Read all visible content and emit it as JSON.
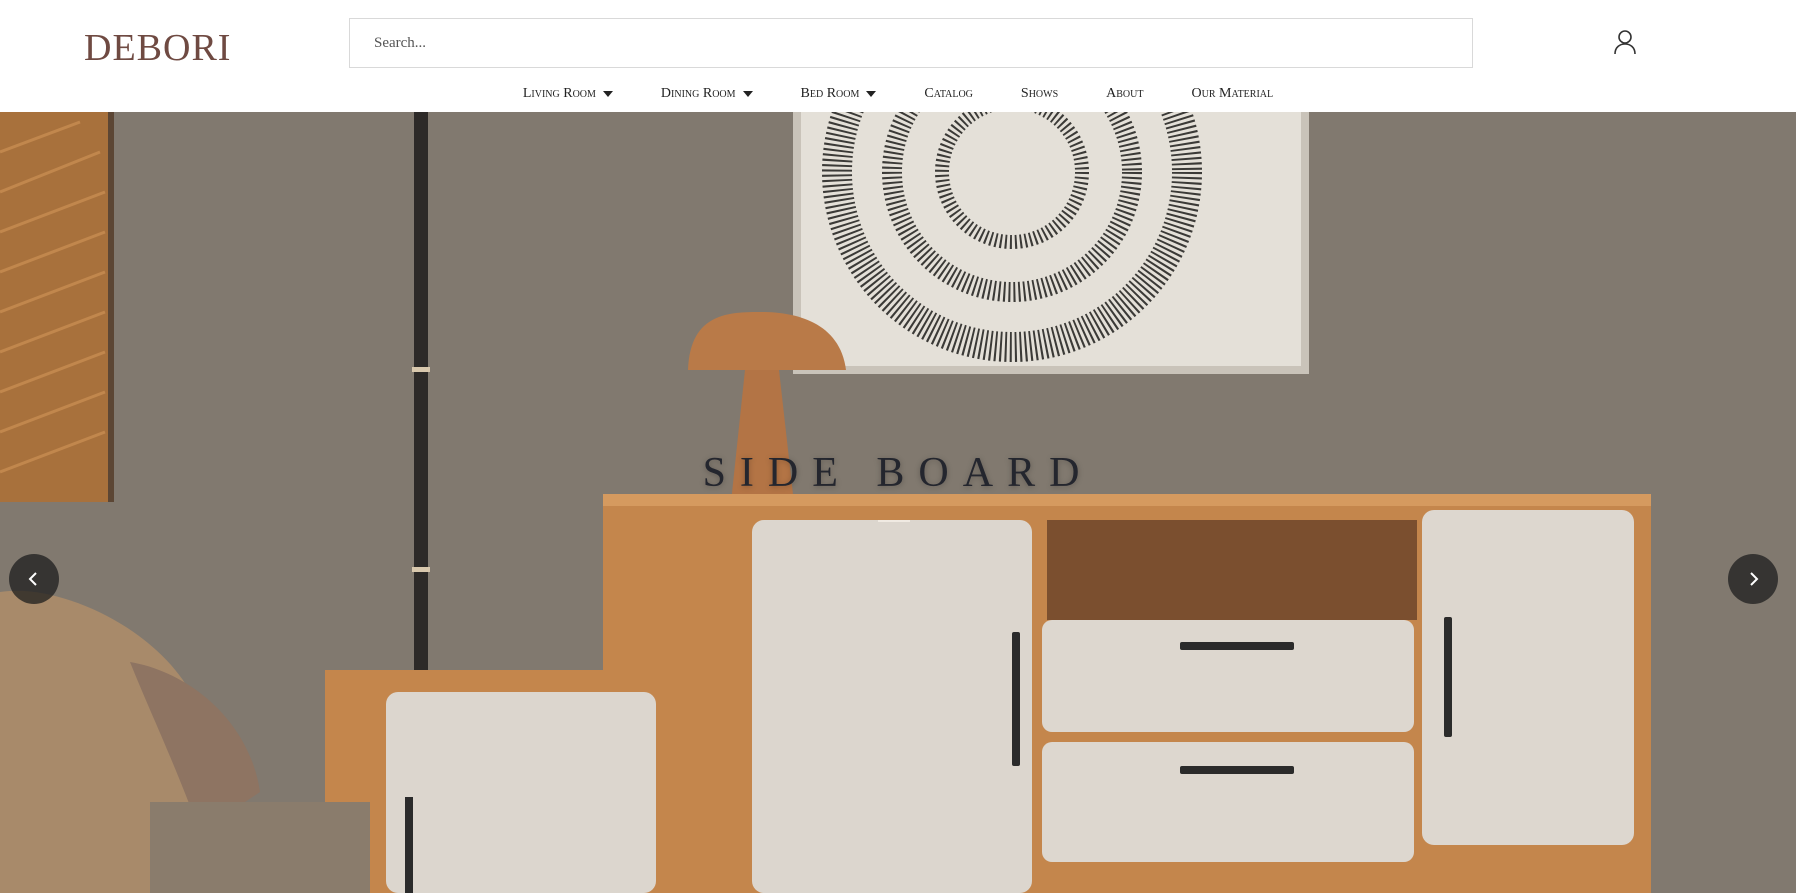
{
  "brand": {
    "name": "DEBORI",
    "color": "#6f4a42"
  },
  "search": {
    "placeholder": "Search..."
  },
  "account": {
    "icon": "user-icon"
  },
  "nav": {
    "items": [
      {
        "label": "Living Room",
        "has_dropdown": true
      },
      {
        "label": "Dining Room",
        "has_dropdown": true
      },
      {
        "label": "Bed Room",
        "has_dropdown": true
      },
      {
        "label": "Catalog",
        "has_dropdown": false
      },
      {
        "label": "Shows",
        "has_dropdown": false
      },
      {
        "label": "About",
        "has_dropdown": false
      },
      {
        "label": "Our Material",
        "has_dropdown": false
      }
    ]
  },
  "hero": {
    "title": "SIDE BOARD",
    "prev_icon": "chevron-left-icon",
    "next_icon": "chevron-right-icon"
  }
}
